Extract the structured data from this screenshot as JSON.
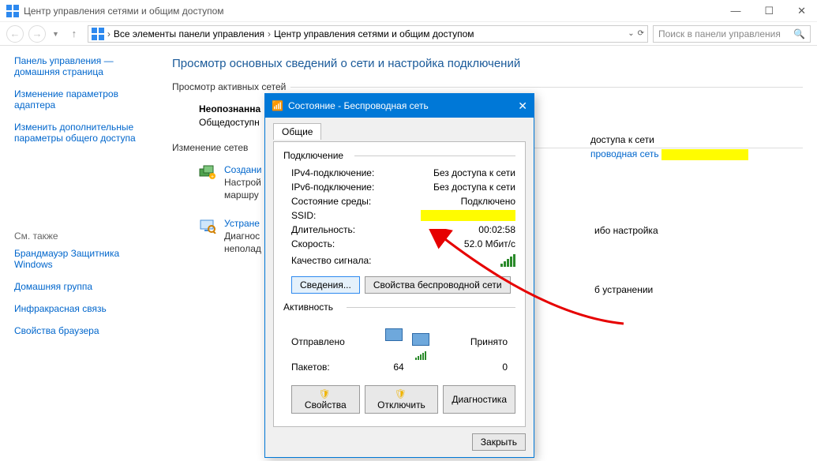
{
  "window": {
    "title": "Центр управления сетями и общим доступом",
    "controls": {
      "minimize": "—",
      "maximize": "☐",
      "close": "✕"
    }
  },
  "nav": {
    "crumb1": "Все элементы панели управления",
    "crumb2": "Центр управления сетями и общим доступом",
    "search_placeholder": "Поиск в панели управления"
  },
  "sidebar": {
    "link_home": "Панель управления — домашняя страница",
    "link_adapter": "Изменение параметров адаптера",
    "link_sharing": "Изменить дополнительные параметры общего доступа",
    "see_also": "См. также",
    "link_fw": "Брандмауэр Защитника Windows",
    "link_homegroup": "Домашняя группа",
    "link_ir": "Инфракрасная связь",
    "link_browser": "Свойства браузера"
  },
  "main": {
    "heading": "Просмотр основных сведений о сети и настройка подключений",
    "active_label": "Просмотр активных сетей",
    "net_name": "Неопознанна",
    "net_sub": "Общедоступн",
    "access_label": "доступа к сети",
    "conn_link": "проводная сеть",
    "change_label": "Изменение сетев",
    "task1_link": "Создани",
    "task1_desc1": "Настрой",
    "task1_desc2": "маршру",
    "task1_note": "ибо настройка",
    "task2_link": "Устране",
    "task2_desc1": "Диагнос",
    "task2_desc2": "неполад",
    "task2_note": "б устранении"
  },
  "modal": {
    "title": "Состояние - Беспроводная сеть",
    "close_icon": "✕",
    "tab_general": "Общие",
    "group_connection": "Подключение",
    "rows": {
      "ipv4_k": "IPv4-подключение:",
      "ipv4_v": "Без доступа к сети",
      "ipv6_k": "IPv6-подключение:",
      "ipv6_v": "Без доступа к сети",
      "media_k": "Состояние среды:",
      "media_v": "Подключено",
      "ssid_k": "SSID:",
      "dur_k": "Длительность:",
      "dur_v": "00:02:58",
      "speed_k": "Скорость:",
      "speed_v": "52.0 Мбит/с",
      "signal_k": "Качество сигнала:"
    },
    "btn_details": "Сведения...",
    "btn_wprops": "Свойства беспроводной сети",
    "group_activity": "Активность",
    "sent": "Отправлено",
    "recv": "Принято",
    "pkt_label": "Пакетов:",
    "pkt_sent": "64",
    "pkt_recv": "0",
    "btn_props": "Свойства",
    "btn_disable": "Отключить",
    "btn_diag": "Диагностика",
    "btn_close": "Закрыть"
  }
}
